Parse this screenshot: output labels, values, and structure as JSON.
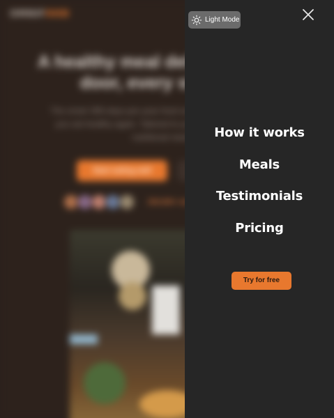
{
  "background": {
    "logo_prefix": "OMNIF",
    "logo_accent": "OOD",
    "headline": "A healthy meal delivered to your door, every single day",
    "subtext": "The smart 365-days-per-year food subscription that will make you eat healthy again. Tailored to your personal tastes and nutritional needs.",
    "cta_label": "Start eating well",
    "deliveries_text": "250,000+ meals delivered last year!",
    "avatar_colors": [
      "#b0704a",
      "#8a6a8a",
      "#c08070",
      "#6a7a9a",
      "#9a8a70"
    ]
  },
  "overlay": {
    "theme_toggle_label": "Light Mode",
    "nav_links": [
      {
        "label": "How it works"
      },
      {
        "label": "Meals"
      },
      {
        "label": "Testimonials"
      },
      {
        "label": "Pricing"
      }
    ],
    "cta_label": "Try for free"
  },
  "colors": {
    "accent": "#e8782e",
    "panel": "#262626",
    "toggle": "#6b6b6b",
    "page_bg": "#2d221c"
  },
  "icons": {
    "theme": "sun-icon",
    "close": "close-icon"
  }
}
